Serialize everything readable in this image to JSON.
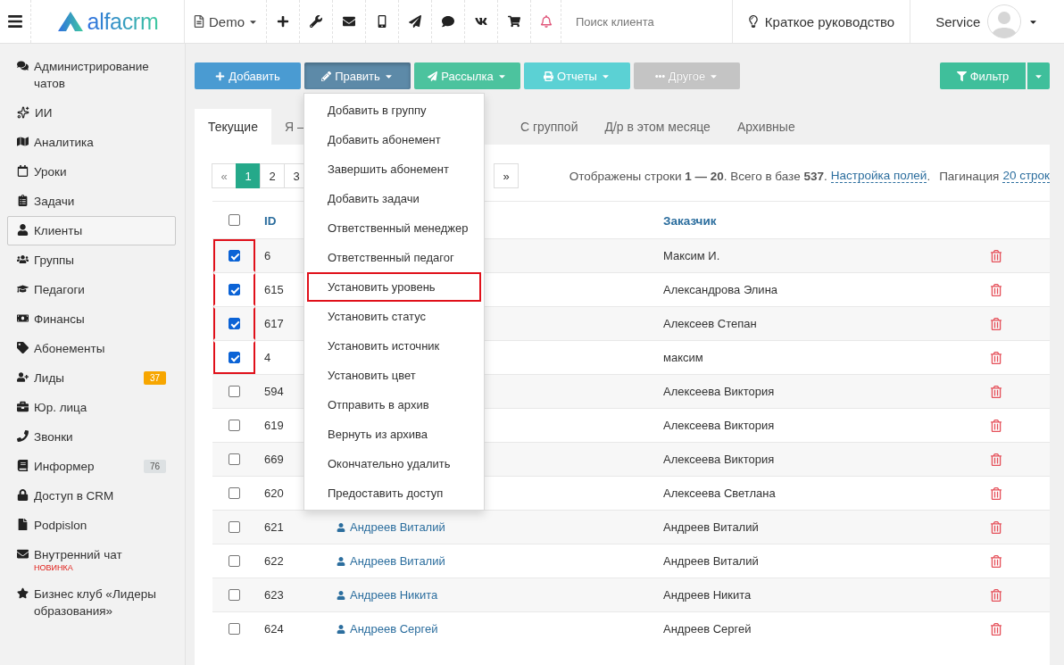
{
  "header": {
    "logo": "alfacrm",
    "branch": "Demo",
    "notifications_unread": true,
    "search": {
      "placeholder": "Поиск клиента"
    },
    "guide": "Краткое руководство",
    "user": "Service"
  },
  "sidebar": {
    "items": [
      {
        "label": "Администрирование чатов",
        "selected": false
      },
      {
        "label": "ИИ",
        "selected": false
      },
      {
        "label": "Аналитика",
        "selected": false
      },
      {
        "label": "Уроки",
        "selected": false
      },
      {
        "label": "Задачи",
        "selected": false
      },
      {
        "label": "Клиенты",
        "selected": true
      },
      {
        "label": "Группы",
        "selected": false
      },
      {
        "label": "Педагоги",
        "selected": false
      },
      {
        "label": "Финансы",
        "selected": false
      },
      {
        "label": "Абонементы",
        "selected": false
      },
      {
        "label": "Лиды",
        "selected": false,
        "badge": "37",
        "color": "#f7a600"
      },
      {
        "label": "Юр. лица",
        "selected": false
      },
      {
        "label": "Звонки",
        "selected": false
      },
      {
        "label": "Информер",
        "selected": false,
        "badge": "76",
        "color": "#dde1e3"
      },
      {
        "label": "Доступ в CRM",
        "selected": false
      },
      {
        "label": "Podpislon",
        "selected": false
      },
      {
        "label": "Внутренний чат",
        "selected": false,
        "note": "НОВИНКА"
      },
      {
        "label": "Бизнес клуб «Лидеры образования»",
        "selected": false
      }
    ]
  },
  "toolbar": {
    "buttons": [
      {
        "label": "Добавить",
        "kind": "add",
        "expanded": false,
        "disabled": false
      },
      {
        "label": "Править",
        "kind": "edit",
        "expanded": true,
        "disabled": false
      },
      {
        "label": "Рассылка",
        "kind": "mail",
        "expanded": false,
        "disabled": false
      },
      {
        "label": "Отчеты",
        "kind": "reports",
        "expanded": false,
        "disabled": false
      },
      {
        "label": "Другое",
        "kind": "other",
        "expanded": false,
        "disabled": true
      }
    ],
    "filter": "Фильтр"
  },
  "dropdown_menu": {
    "items": [
      {
        "label": "Добавить в группу",
        "highlighted": false
      },
      {
        "label": "Добавить абонемент",
        "highlighted": false
      },
      {
        "label": "Завершить абонемент",
        "highlighted": false
      },
      {
        "label": "Добавить задачи",
        "highlighted": false
      },
      {
        "label": "Ответственный менеджер",
        "highlighted": false
      },
      {
        "label": "Ответственный педагог",
        "highlighted": false
      },
      {
        "label": "Установить уровень",
        "highlighted": true
      },
      {
        "label": "Установить статус",
        "highlighted": false
      },
      {
        "label": "Установить источник",
        "highlighted": false
      },
      {
        "label": "Установить цвет",
        "highlighted": false
      },
      {
        "label": "Отправить в архив",
        "highlighted": false
      },
      {
        "label": "Вернуть из архива",
        "highlighted": false
      },
      {
        "label": "Окончательно удалить",
        "highlighted": false
      },
      {
        "label": "Предоставить доступ",
        "highlighted": false
      }
    ]
  },
  "tabs": [
    {
      "label": "Текущие",
      "selected": true
    },
    {
      "label": "Я —",
      "selected": false
    },
    {
      "label": "С группой",
      "selected": false
    },
    {
      "label": "Д/р в этом месяце",
      "selected": false
    },
    {
      "label": "Архивные",
      "selected": false
    }
  ],
  "pagination": {
    "prev": "«",
    "pages": [
      {
        "label": "1",
        "selected": true
      },
      {
        "label": "2",
        "selected": false
      },
      {
        "label": "3",
        "selected": false
      }
    ],
    "next": "»"
  },
  "summary": {
    "text": "Отображены строки **1 — 20**. Всего в базе **537**.",
    "fields_link": "Настройка полей",
    "period": ".",
    "pagination_label": "Пагинация",
    "pagination_link": "20 строк"
  },
  "table": {
    "columns": [
      "ID",
      "Заказчик"
    ],
    "all_checked": false,
    "rows": [
      {
        "id": "6",
        "customer": "Максим И.",
        "checked": true,
        "highlighted": true
      },
      {
        "id": "615",
        "customer": "Александрова Элина",
        "checked": true,
        "highlighted": true
      },
      {
        "id": "617",
        "customer": "Алексеев Степан",
        "checked": true,
        "highlighted": true
      },
      {
        "id": "4",
        "customer": "максим",
        "checked": true,
        "highlighted": true
      },
      {
        "id": "594",
        "customer": "Алексеева Виктория",
        "checked": false,
        "highlighted": false
      },
      {
        "id": "619",
        "customer": "Алексеева Виктория",
        "checked": false,
        "highlighted": false
      },
      {
        "id": "669",
        "customer": "Алексеева Виктория",
        "checked": false,
        "highlighted": false
      },
      {
        "id": "620",
        "customer": "Алексеева Светлана",
        "checked": false,
        "highlighted": false
      },
      {
        "id": "621",
        "name": "Андреев Виталий",
        "customer": "Андреев Виталий",
        "checked": false,
        "highlighted": false
      },
      {
        "id": "622",
        "name": "Андреев Виталий",
        "customer": "Андреев Виталий",
        "checked": false,
        "highlighted": false
      },
      {
        "id": "623",
        "name": "Андреев Никита",
        "customer": "Андреев Никита",
        "checked": false,
        "highlighted": false
      },
      {
        "id": "624",
        "name": "Андреев Сергей",
        "customer": "Андреев Сергей",
        "checked": false,
        "highlighted": false
      }
    ]
  }
}
